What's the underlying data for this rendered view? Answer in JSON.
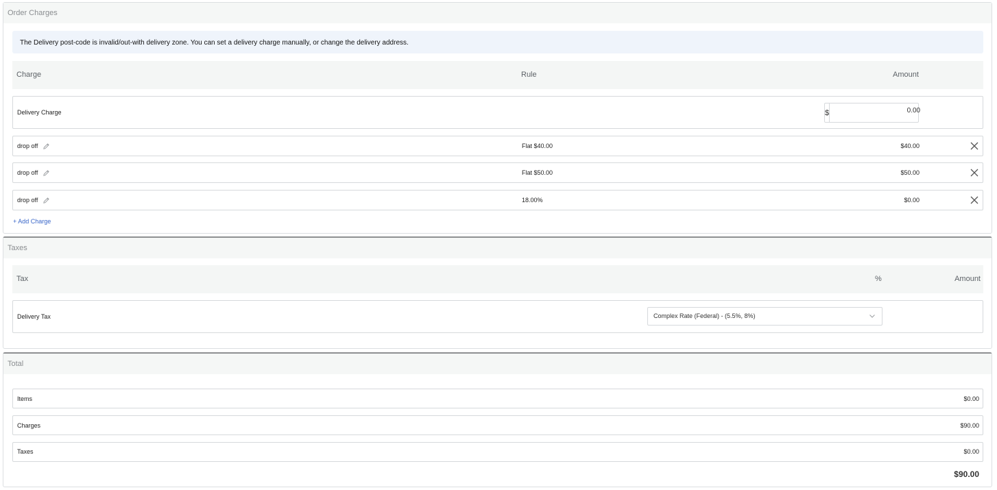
{
  "order_charges": {
    "title": "Order Charges",
    "alert": "The Delivery post-code is invalid/out-with delivery zone. You can set a delivery charge manually, or change the delivery address.",
    "columns": {
      "charge": "Charge",
      "rule": "Rule",
      "amount": "Amount"
    },
    "delivery": {
      "label": "Delivery Charge",
      "currency": "$",
      "value": "0.00"
    },
    "rows": [
      {
        "name": "drop off",
        "rule": "Flat $40.00",
        "amount": "$40.00"
      },
      {
        "name": "drop off",
        "rule": "Flat $50.00",
        "amount": "$50.00"
      },
      {
        "name": "drop off",
        "rule": "18.00%",
        "amount": "$0.00"
      }
    ],
    "add_charge": "Add Charge"
  },
  "taxes": {
    "title": "Taxes",
    "columns": {
      "tax": "Tax",
      "percent": "%",
      "amount": "Amount"
    },
    "rows": [
      {
        "name": "Delivery Tax",
        "selected": "Complex Rate (Federal) - (5.5%, 8%)"
      }
    ]
  },
  "total": {
    "title": "Total",
    "rows": [
      {
        "label": "Items",
        "value": "$0.00"
      },
      {
        "label": "Charges",
        "value": "$90.00"
      },
      {
        "label": "Taxes",
        "value": "$0.00"
      }
    ],
    "grand_total": "$90.00"
  },
  "colors": {
    "accent": "#3a67c9",
    "alert_bg": "#eff4fb",
    "header_bg": "#f5f7f6"
  }
}
